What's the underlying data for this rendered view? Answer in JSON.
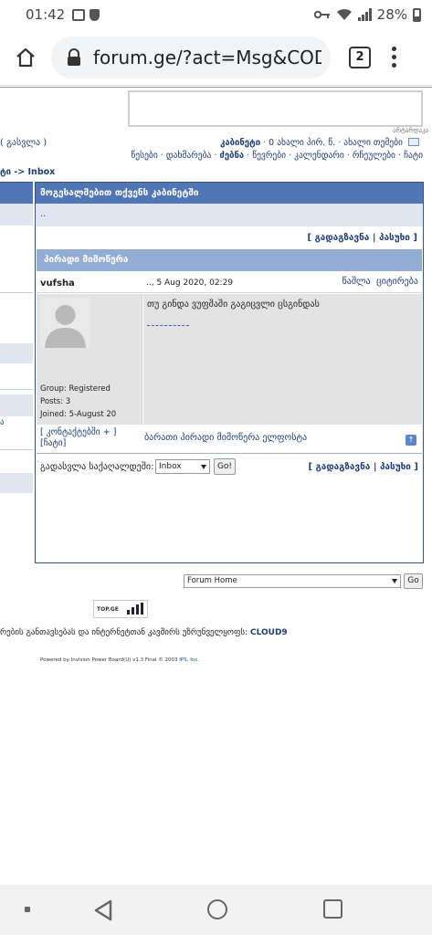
{
  "status_bar": {
    "time": "01:42",
    "battery": "28%"
  },
  "browser": {
    "url": "forum.ge/?act=Msg&CODE=",
    "tab_count": "2"
  },
  "header": {
    "tiny_link": "არტარდაკა",
    "logout": "( გასვლა )",
    "nav1": {
      "cabinet": "კაბინეტი",
      "new_pm": "0 ახალი პირ. წ.",
      "new_topics": "ახალი თემები"
    },
    "nav2": {
      "rules": "წესები",
      "help": "დახმარება",
      "search": "ძებნა",
      "members": "წევრები",
      "calendar": "კალენდარი",
      "ads": "რჩეულები",
      "chat": "ჩატი"
    },
    "breadcrumb": "ტი -> Inbox",
    "left_arrow": "ა"
  },
  "main": {
    "title": "მოგესალმებით თქვენს კაბინეტში",
    "dots": "..",
    "actions_top": "[ გადაგზავნა | პასუხი ]",
    "section_head": "პირადი მიმოწერა",
    "poster": "vufsha",
    "date": ".., 5 Aug 2020, 02:29",
    "delete": "წაშლა",
    "quote": "ციტირება",
    "message": "თუ გინდა ვუფშაში გაგიცვლი ცსგინდას",
    "author": {
      "group": "Group: Registered",
      "posts": "Posts: 3",
      "joined": "Joined: 5-August 20"
    },
    "contacts_line1": "[ კონტაქტებში + ]",
    "contacts_line2": "[ჩატი]",
    "forward_link": "ბარათი პირადი მიმოწერა ელფოსტა",
    "jump_label": "გადასვლა საქაღალდეში:",
    "jump_value": "Inbox",
    "go": "Go!",
    "actions_bottom": "[ გადაგზავნა | პასუხი ]"
  },
  "footer": {
    "forum_select": "Forum Home",
    "go": "Go",
    "topge": "TOP.GE",
    "provider_text": "რების განთავსებას და ინტერნეტთან კავშირს უზრუნველყოფს:",
    "provider_name": "CLOUD9",
    "powered": "Powered by Invision Power Board(U) v1.3 Final © 2003",
    "powered_link": "IPS, Inc."
  }
}
